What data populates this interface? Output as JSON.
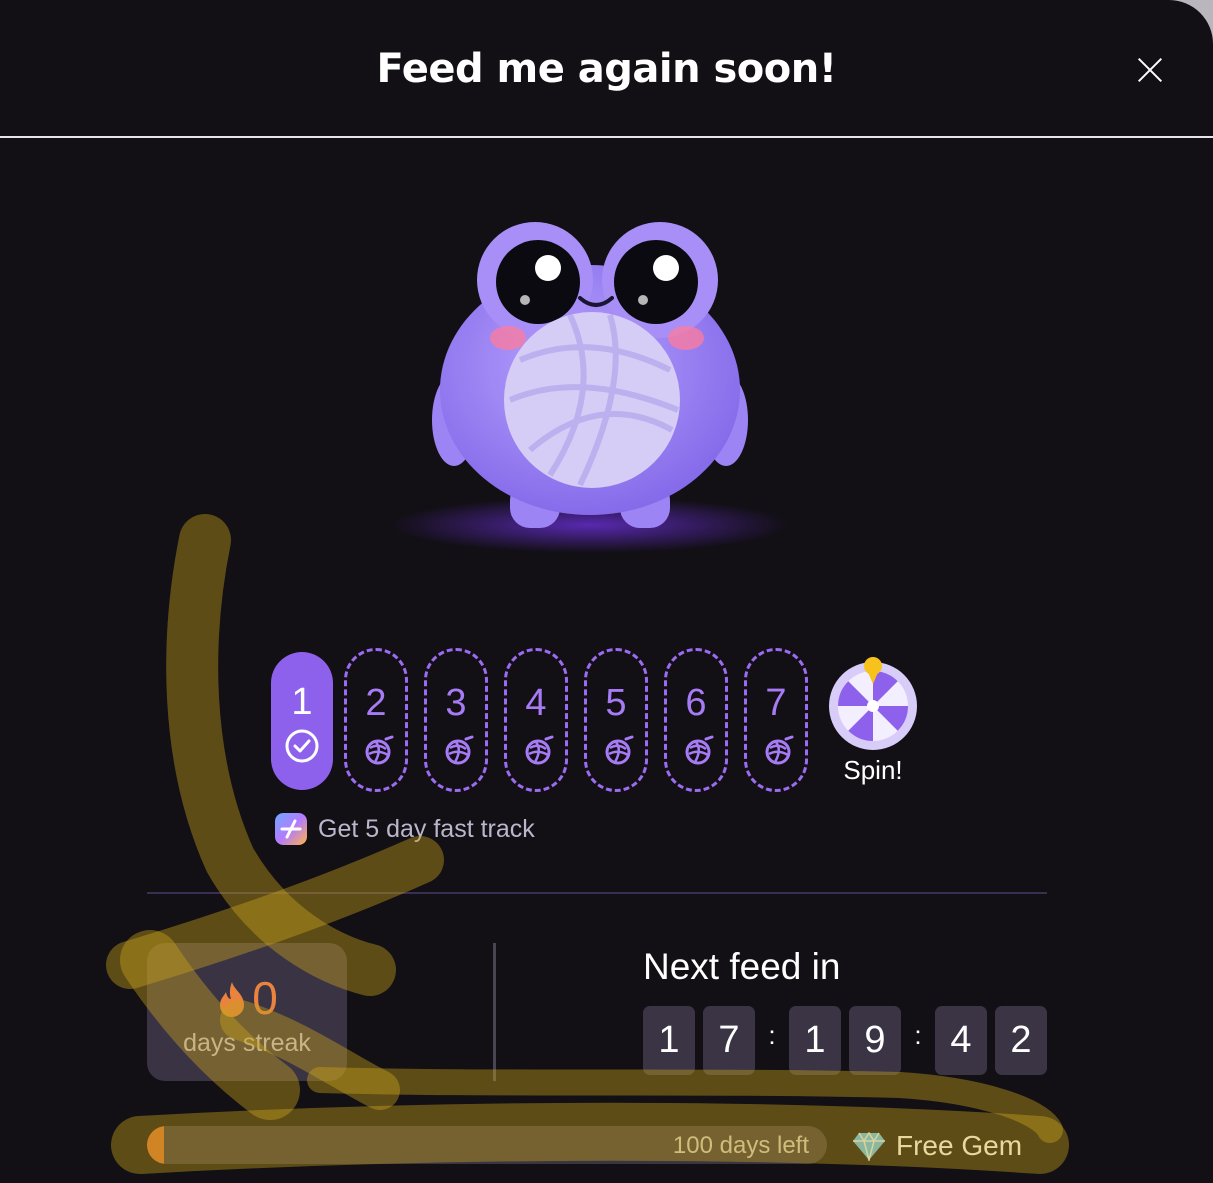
{
  "modal": {
    "title": "Feed me again soon!",
    "close_icon": "close-icon"
  },
  "streak_days": {
    "days": [
      {
        "label": "1",
        "status": "completed",
        "icon": "check-circle-icon"
      },
      {
        "label": "2",
        "status": "upcoming",
        "icon": "yarn-icon"
      },
      {
        "label": "3",
        "status": "upcoming",
        "icon": "yarn-icon"
      },
      {
        "label": "4",
        "status": "upcoming",
        "icon": "yarn-icon"
      },
      {
        "label": "5",
        "status": "upcoming",
        "icon": "yarn-icon"
      },
      {
        "label": "6",
        "status": "upcoming",
        "icon": "yarn-icon"
      },
      {
        "label": "7",
        "status": "upcoming",
        "icon": "yarn-icon"
      }
    ],
    "spin_label": "Spin!"
  },
  "fast_track": {
    "text": "Get 5 day fast track"
  },
  "streak": {
    "count": "0",
    "label": "days streak"
  },
  "next_feed": {
    "label": "Next feed in",
    "digits": [
      "1",
      "7",
      "1",
      "9",
      "4",
      "2"
    ],
    "separator": ":"
  },
  "progress": {
    "text": "100 days left",
    "fraction": 0.025
  },
  "free_gem": {
    "label": "Free Gem"
  },
  "colors": {
    "accent": "#8d61ec",
    "streak_orange": "#e9833e",
    "highlight": "#c9a21a"
  }
}
